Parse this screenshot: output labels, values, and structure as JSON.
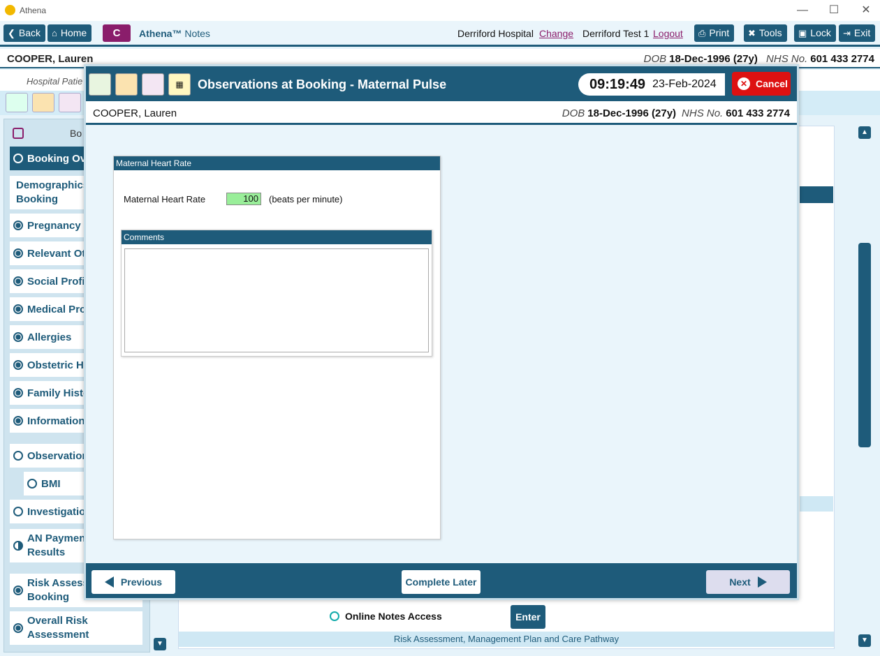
{
  "window": {
    "title": "Athena"
  },
  "toolbar": {
    "back": "Back",
    "home": "Home",
    "c": "C",
    "app_name": "Athena™",
    "app_suffix": "Notes",
    "hospital": "Derriford Hospital",
    "change": "Change",
    "user": "Derriford Test 1",
    "logout": "Logout",
    "print": "Print",
    "tools": "Tools",
    "lock": "Lock",
    "exit": "Exit"
  },
  "patient": {
    "name": "COOPER, Lauren",
    "dob_label": "DOB",
    "dob": "18-Dec-1996 (27y)",
    "nhs_label": "NHS No.",
    "nhs": "601 433 2774"
  },
  "sub": {
    "hospital_patient": "Hospital Patie"
  },
  "sidebar": {
    "header": "Bo",
    "items": [
      {
        "label": "Booking Ov",
        "state": "empty"
      },
      {
        "label": "Demographics",
        "label2": "Booking",
        "state": "none"
      },
      {
        "label": "Pregnancy I",
        "state": "filled"
      },
      {
        "label": "Relevant Ot",
        "state": "filled"
      },
      {
        "label": "Social Profil",
        "state": "filled"
      },
      {
        "label": "Medical Pro",
        "state": "filled"
      },
      {
        "label": "Allergies",
        "state": "filled"
      },
      {
        "label": "Obstetric H",
        "state": "filled"
      },
      {
        "label": "Family Histo",
        "state": "filled"
      },
      {
        "label": "Information",
        "state": "filled"
      },
      {
        "label": "Observation",
        "state": "empty"
      },
      {
        "label": "BMI",
        "state": "empty"
      },
      {
        "label": "Investigatio",
        "state": "empty"
      },
      {
        "label": "AN Paymen",
        "label2": "Results",
        "state": "half"
      },
      {
        "label": "Risk Assess",
        "label2": "Booking",
        "state": "filled"
      },
      {
        "label": "Overall Risk",
        "label2": "Assessment",
        "state": "filled"
      }
    ]
  },
  "modal": {
    "title": "Observations at Booking - Maternal Pulse",
    "time": "09:19:49",
    "date": "23-Feb-2024",
    "cancel": "Cancel"
  },
  "form": {
    "section": "Maternal Heart Rate",
    "hr_label": "Maternal Heart Rate",
    "hr_value": "100",
    "hr_unit": "(beats per minute)",
    "comments_label": "Comments",
    "comments": ""
  },
  "footer": {
    "previous": "Previous",
    "complete_later": "Complete Later",
    "next": "Next"
  },
  "background": {
    "online_notes": "Online Notes Access",
    "enter": "Enter",
    "risk_bar": "Risk Assessment, Management Plan and Care Pathway"
  }
}
